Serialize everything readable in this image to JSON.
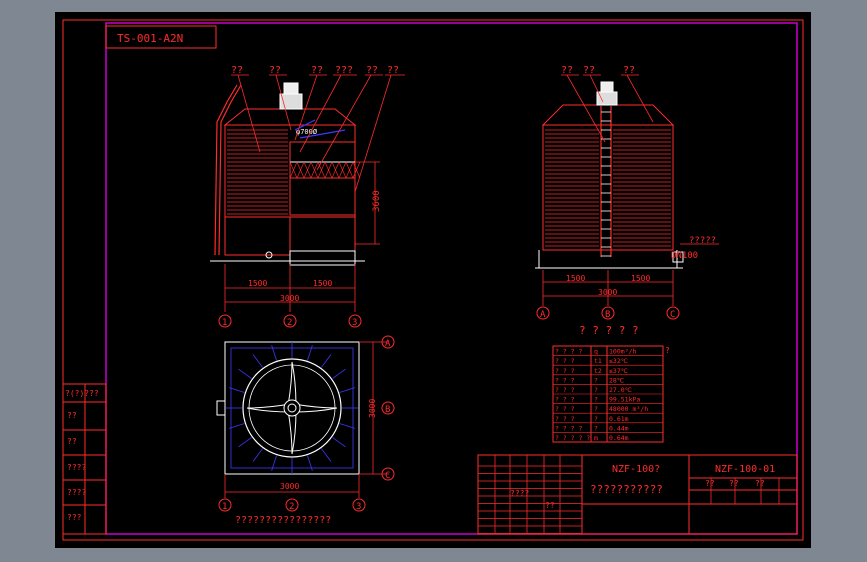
{
  "drawing_code": "TS-001-A2N",
  "title_block": {
    "model": "NZF-100?",
    "drawing_no": "NZF-100-01",
    "name_line": "???????????",
    "small_labels": [
      "??",
      "??",
      "??",
      "????",
      "??"
    ]
  },
  "left_margin_labels": [
    "?(?)???",
    "??",
    "??",
    "????",
    "????",
    "???"
  ],
  "front_view": {
    "callouts": [
      "??",
      "??",
      "??",
      "???",
      "??",
      "??"
    ],
    "dimensions": [
      "1500",
      "1500",
      "3000",
      "3600"
    ],
    "labels": [
      "φ700Ø"
    ],
    "axes": [
      "1",
      "2",
      "3"
    ]
  },
  "side_view": {
    "callouts": [
      "??",
      "??",
      "??"
    ],
    "dimensions": [
      "1500",
      "1500",
      "3000"
    ],
    "labels": [
      "?????",
      "DN100"
    ],
    "axes": [
      "A",
      "B",
      "C"
    ]
  },
  "plan_view": {
    "dimensions": [
      "3000",
      "3000"
    ],
    "axes_right": [
      "A",
      "B",
      "C"
    ],
    "axes_bottom": [
      "1",
      "2",
      "3"
    ],
    "caption": "????????????????"
  },
  "spec_table": {
    "title": "? ? ? ? ?",
    "note": "?",
    "header": [
      "? ? ? ?",
      "q",
      "100m³/h"
    ],
    "rows": [
      [
        "? ? ?",
        "t1",
        "≤32℃"
      ],
      [
        "? ? ?",
        "t2",
        "≤37℃"
      ],
      [
        "? ? ?",
        "?",
        "28℃"
      ],
      [
        "? ? ?",
        "?",
        "27.0℃"
      ],
      [
        "? ? ?",
        "?",
        "99.51kPa"
      ],
      [
        "? ? ?",
        "?",
        "48000 m³/h"
      ],
      [
        "? ? ?",
        "?",
        "0.61m"
      ],
      [
        "? ? ? ?",
        "?",
        "0.44m"
      ],
      [
        "? ? ? ? ?",
        "m",
        "0.64m"
      ]
    ]
  },
  "colors": {
    "line": "#ff2b2b",
    "frame": "#cc00cc",
    "blue": "#3b3bff",
    "white": "#ffffff"
  }
}
